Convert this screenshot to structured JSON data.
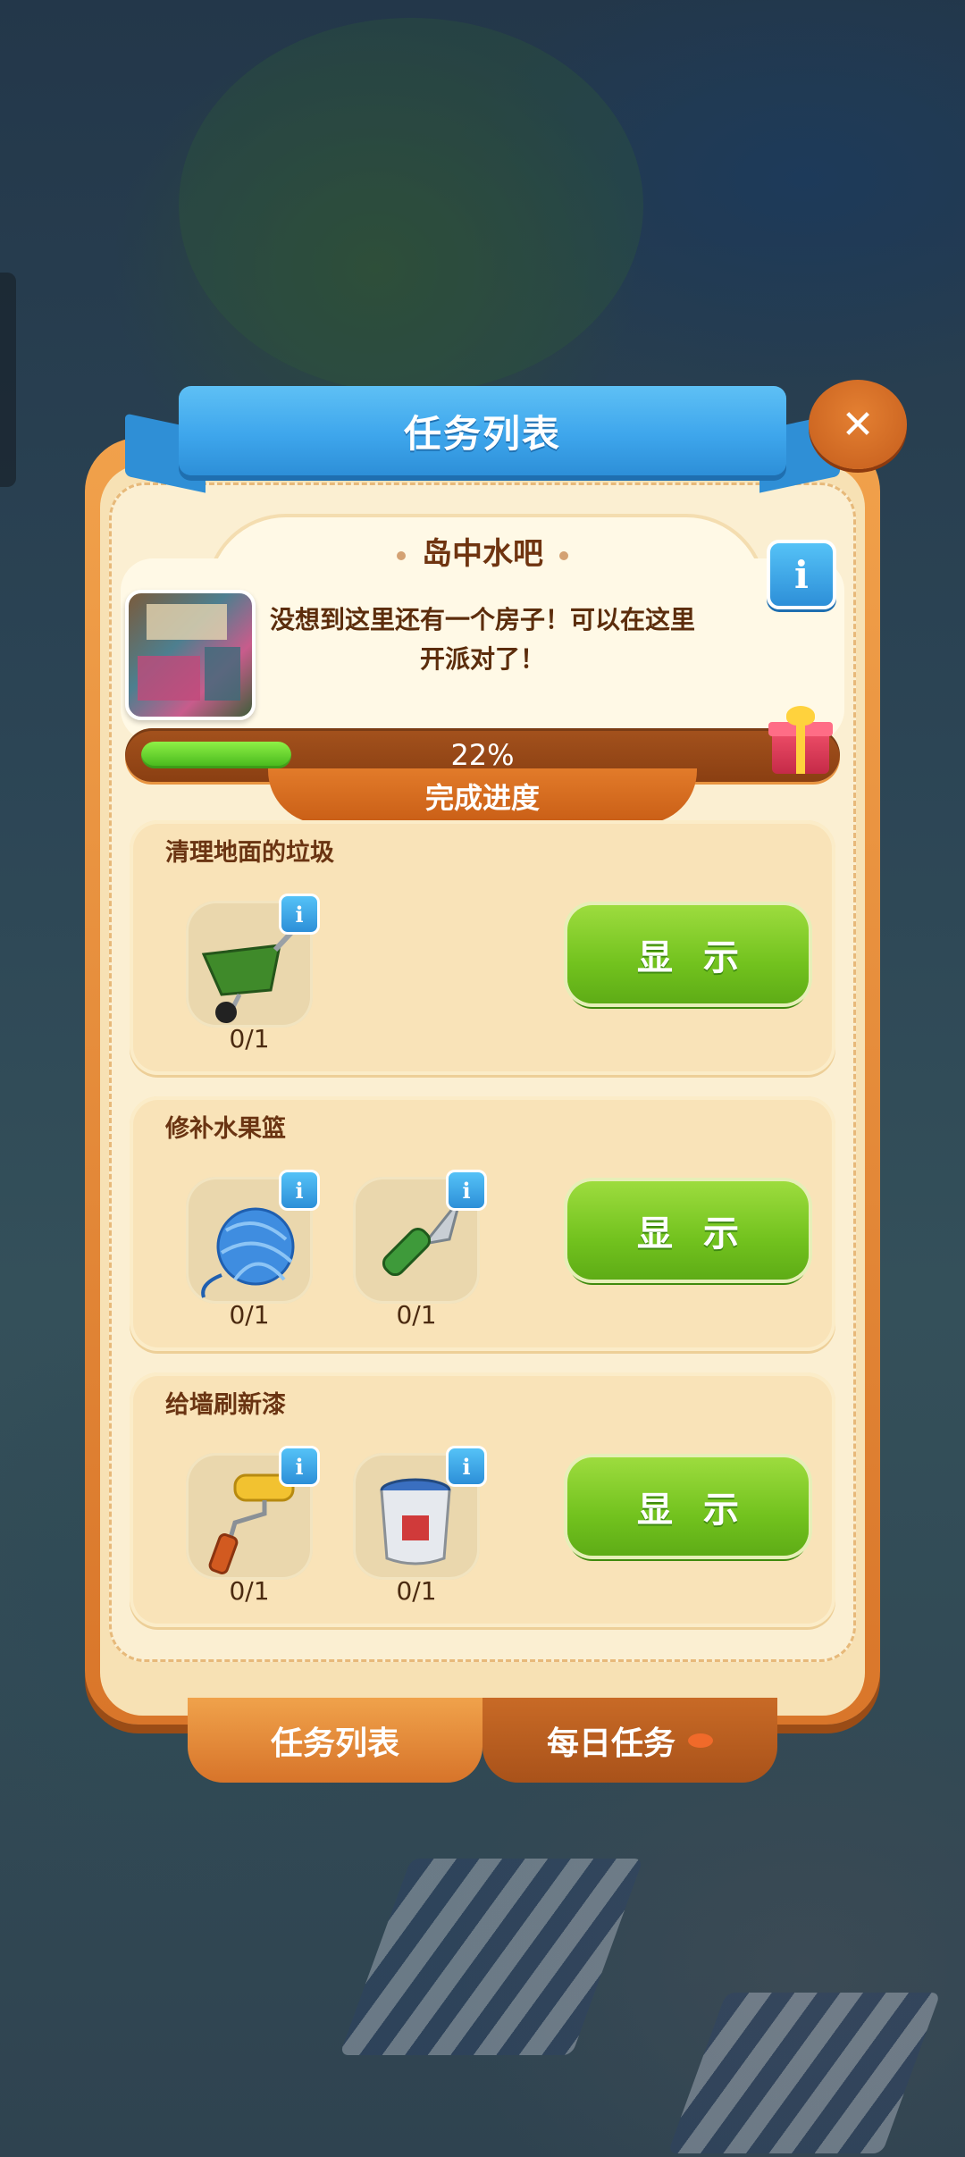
{
  "window": {
    "title": "任务列表",
    "close_glyph": "✕"
  },
  "area": {
    "name": "岛中水吧",
    "description": "没想到这里还有一个房子！可以在这里开派对了！",
    "info_glyph": "i"
  },
  "progress": {
    "value": 0.22,
    "text": "22%",
    "label": "完成进度"
  },
  "tasks": [
    {
      "title": "清理地面的垃圾",
      "button": "显示",
      "items": [
        {
          "icon": "wheelbarrow-icon",
          "count": "0/1"
        }
      ]
    },
    {
      "title": "修补水果篮",
      "button": "显示",
      "items": [
        {
          "icon": "yarn-ball-icon",
          "count": "0/1"
        },
        {
          "icon": "knife-icon",
          "count": "0/1"
        }
      ]
    },
    {
      "title": "给墙刷新漆",
      "button": "显示",
      "items": [
        {
          "icon": "paint-roller-icon",
          "count": "0/1"
        },
        {
          "icon": "paint-bucket-icon",
          "count": "0/1"
        }
      ]
    }
  ],
  "tabs": {
    "task_list": "任务列表",
    "daily_tasks": "每日任务"
  },
  "colors": {
    "accent_blue": "#3ea6ec",
    "panel_orange": "#d9762a",
    "button_green": "#72c21e"
  }
}
